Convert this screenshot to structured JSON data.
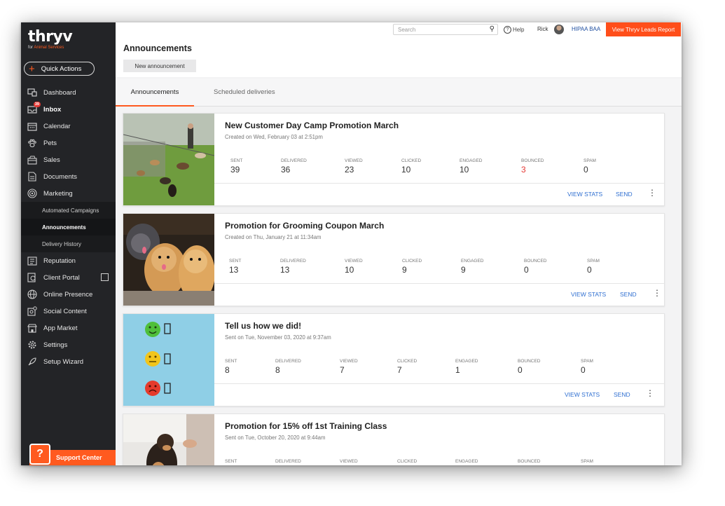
{
  "brand": {
    "name": "thryv",
    "sub_prefix": "for ",
    "sub_accent": "Animal Services"
  },
  "quick_actions_label": "Quick Actions",
  "nav": [
    {
      "label": "Dashboard",
      "icon": "dashboard-icon"
    },
    {
      "label": "Inbox",
      "icon": "inbox-icon",
      "badge": "39"
    },
    {
      "label": "Calendar",
      "icon": "calendar-icon"
    },
    {
      "label": "Pets",
      "icon": "paw-icon"
    },
    {
      "label": "Sales",
      "icon": "sales-icon"
    },
    {
      "label": "Documents",
      "icon": "document-icon"
    },
    {
      "label": "Marketing",
      "icon": "target-icon"
    }
  ],
  "marketing_sub": [
    "Automated Campaigns",
    "Announcements",
    "Delivery History"
  ],
  "nav2": [
    {
      "label": "Reputation",
      "icon": "reputation-icon"
    },
    {
      "label": "Client Portal",
      "icon": "portal-icon"
    },
    {
      "label": "Online Presence",
      "icon": "globe-icon"
    },
    {
      "label": "Social Content",
      "icon": "social-icon"
    },
    {
      "label": "App Market",
      "icon": "store-icon"
    },
    {
      "label": "Settings",
      "icon": "gear-icon"
    },
    {
      "label": "Setup Wizard",
      "icon": "rocket-icon"
    }
  ],
  "support_label": "Support Center",
  "topbar": {
    "search_placeholder": "Search",
    "help": "Help",
    "user": "Rick",
    "hipaa": "HIPAA BAA",
    "leads_button": "View Thryv Leads Report"
  },
  "page_title": "Announcements",
  "new_button": "New announcement",
  "tabs": [
    "Announcements",
    "Scheduled deliveries"
  ],
  "stat_labels": [
    "SENT",
    "DELIVERED",
    "VIEWED",
    "CLICKED",
    "ENGAGED",
    "BOUNCED",
    "SPAM"
  ],
  "actions": {
    "view_stats": "VIEW STATS",
    "send": "SEND"
  },
  "cards": [
    {
      "title": "New Customer Day Camp Promotion March",
      "subtitle": "Created on Wed, February 03 at 2:51pm",
      "stats": [
        "39",
        "36",
        "23",
        "10",
        "10",
        "3",
        "0"
      ]
    },
    {
      "title": "Promotion for Grooming Coupon March",
      "subtitle": "Created on Thu, January 21 at 11:34am",
      "stats": [
        "13",
        "13",
        "10",
        "9",
        "9",
        "0",
        "0"
      ]
    },
    {
      "title": "Tell us how we did!",
      "subtitle": "Sent on Tue, November 03, 2020 at 9:37am",
      "stats": [
        "8",
        "8",
        "7",
        "7",
        "1",
        "0",
        "0"
      ]
    },
    {
      "title": "Promotion for 15% off 1st Training Class",
      "subtitle": "Sent on Tue, October 20, 2020 at 9:44am",
      "stats": [
        "",
        "",
        "",
        "",
        "",
        "",
        ""
      ]
    }
  ]
}
